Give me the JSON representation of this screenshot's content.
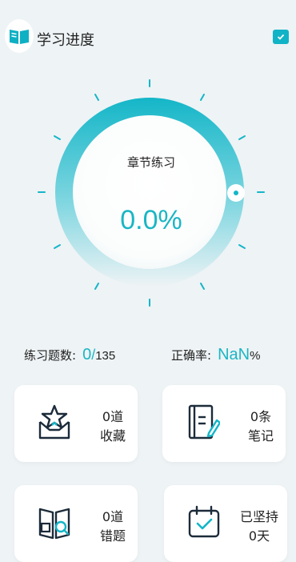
{
  "header": {
    "title": "学习进度",
    "logo_icon": "open-book-icon",
    "calendar_icon": "calendar-check-icon"
  },
  "dial": {
    "label": "章节练习",
    "percent_text": "0.0%",
    "progress": 0.0,
    "accent": "#1ab6c4"
  },
  "stats": {
    "practice_label": "练习题数:",
    "practice_done": "0",
    "practice_sep": "/",
    "practice_total": "135",
    "accuracy_label": "正确率:",
    "accuracy_value": "NaN",
    "accuracy_unit": "%"
  },
  "cards": {
    "favorites": {
      "count": "0道",
      "label": "收藏",
      "icon": "star-inbox-icon"
    },
    "notes": {
      "count": "0条",
      "label": "笔记",
      "icon": "notebook-pen-icon"
    },
    "mistakes": {
      "count": "0道",
      "label": "错题",
      "icon": "book-magnifier-icon"
    },
    "streak": {
      "count": "已坚持",
      "label": "0天",
      "icon": "calendar-check-icon"
    }
  }
}
